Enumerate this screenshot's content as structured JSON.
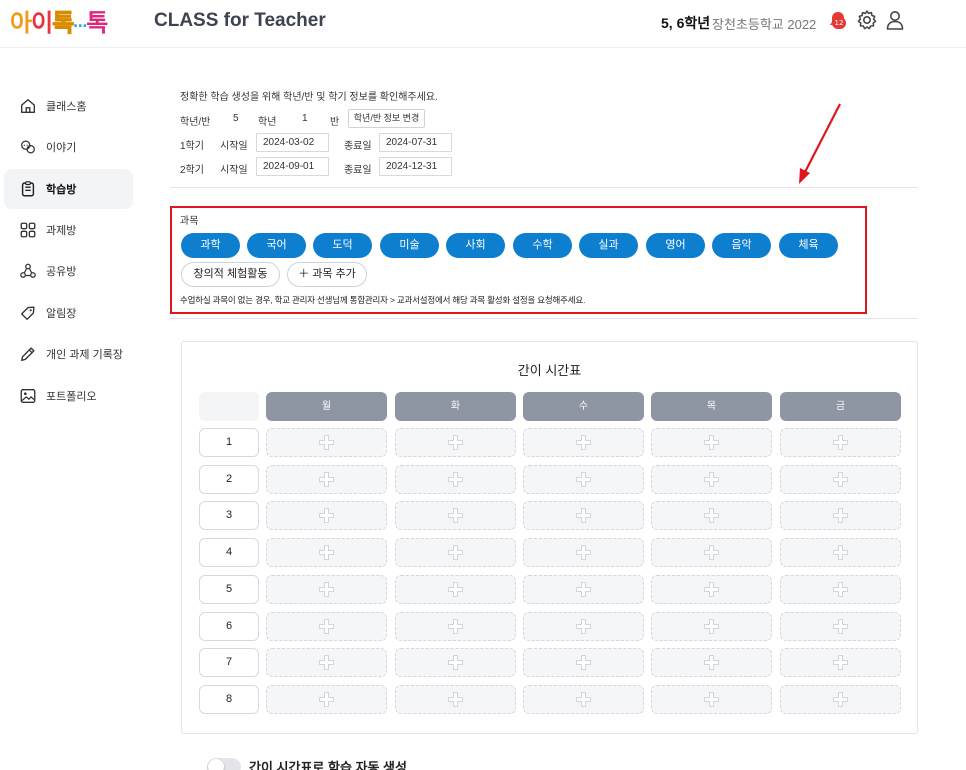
{
  "header": {
    "logo_chars": [
      "아",
      "이",
      "톡",
      "…",
      "톡"
    ],
    "app_title": "CLASS for Teacher",
    "grade": "5, 6학년",
    "school": "장천초등학교 2022",
    "notification_count": "12",
    "icons": [
      "bell-icon",
      "gear-icon",
      "user-icon"
    ]
  },
  "sidebar": {
    "items": [
      {
        "label": "클래스홈",
        "icon": "home-icon"
      },
      {
        "label": "이야기",
        "icon": "chat-icon"
      },
      {
        "label": "학습방",
        "icon": "clipboard-icon",
        "active": true
      },
      {
        "label": "과제방",
        "icon": "grid-icon"
      },
      {
        "label": "공유방",
        "icon": "share-icon"
      },
      {
        "label": "알림장",
        "icon": "tag-icon"
      },
      {
        "label": "개인 과제 기록장",
        "icon": "pencil-icon"
      },
      {
        "label": "포트폴리오",
        "icon": "image-icon"
      }
    ]
  },
  "info": {
    "instruction": "정확한 학습 생성을 위해 학년/반 및 학기 정보를 확인해주세요.",
    "grade_class_label": "학년/반",
    "grade_value": "5",
    "grade_unit": "학년",
    "class_value": "1",
    "class_unit": "반",
    "change_button": "학년/반 정보 변경",
    "semesters": [
      {
        "label": "1학기",
        "start_label": "시작일",
        "start": "2024-03-02",
        "end_label": "종료일",
        "end": "2024-07-31"
      },
      {
        "label": "2학기",
        "start_label": "시작일",
        "start": "2024-09-01",
        "end_label": "종료일",
        "end": "2024-12-31"
      }
    ]
  },
  "subjects": {
    "title": "과목",
    "items": [
      "과학",
      "국어",
      "도덕",
      "미술",
      "사회",
      "수학",
      "실과",
      "영어",
      "음악",
      "체육"
    ],
    "extra": "창의적 체험활동",
    "add_button": "＋ 과목 추가",
    "note": "수업하실 과목이 없는 경우, 학교 관리자 선생님께 통합관리자 > 교과서설정에서 해당 과목 활성화 설정을 요청해주세요."
  },
  "timetable": {
    "title": "간이 시간표",
    "days": [
      "월",
      "화",
      "수",
      "목",
      "금"
    ],
    "periods": [
      "1",
      "2",
      "3",
      "4",
      "5",
      "6",
      "7",
      "8"
    ]
  },
  "toggle": {
    "label": "간이 시간표로 학습 자동 생성",
    "on": false
  },
  "colors": {
    "accent": "#0e7fcf",
    "highlight_border": "#e0161e",
    "day_header": "#8e95a3"
  }
}
